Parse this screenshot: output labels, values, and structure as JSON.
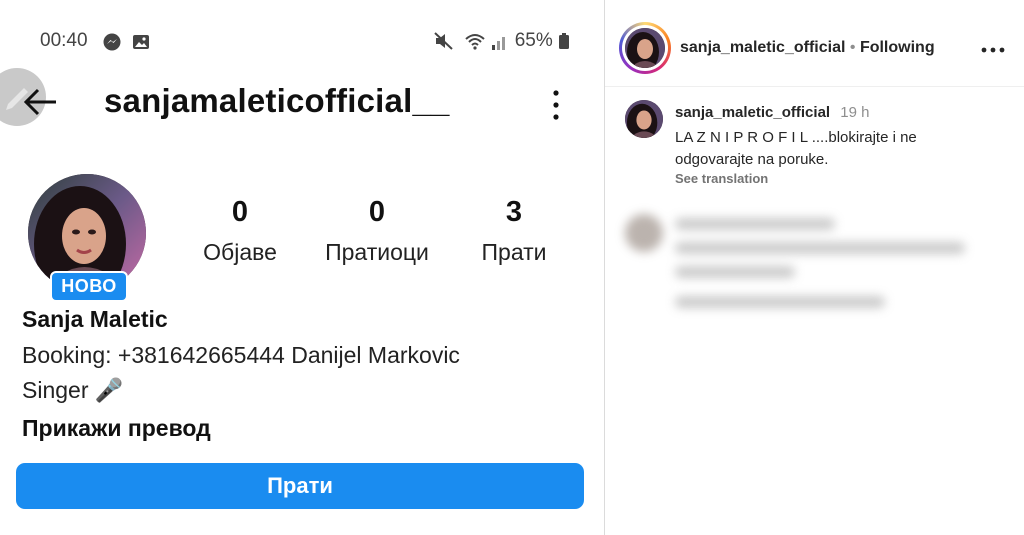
{
  "status_bar": {
    "time": "00:40",
    "battery": "65%",
    "icons": [
      "messenger-icon",
      "gallery-icon",
      "mute-icon",
      "wifi-icon",
      "signal-icon",
      "battery-icon"
    ]
  },
  "profile": {
    "username": "sanjamaleticofficial__",
    "badge": "НОВО",
    "stats": {
      "posts": {
        "value": "0",
        "label": "Објаве"
      },
      "followers": {
        "value": "0",
        "label": "Пратиоци"
      },
      "following": {
        "value": "3",
        "label": "Прати"
      }
    },
    "display_name": "Sanja Maletic",
    "bio_line1": "Booking: +381642665444 Danijel Markovic",
    "bio_line2": "Singer 🎤",
    "translate_label": "Прикажи превод",
    "follow_button": "Прати"
  },
  "post_panel": {
    "author": "sanja_maletic_official",
    "separator": "•",
    "follow_state": "Following",
    "more_icon": "more-horizontal-icon",
    "comment": {
      "user": "sanja_maletic_official",
      "time": "19 h",
      "text": "LA Z N I P R O F I L ....blokirajte i ne odgovarajte na poruke.",
      "see_translation": "See translation"
    }
  },
  "colors": {
    "accent": "#1a8cf0",
    "muted": "#8e8e8e"
  }
}
